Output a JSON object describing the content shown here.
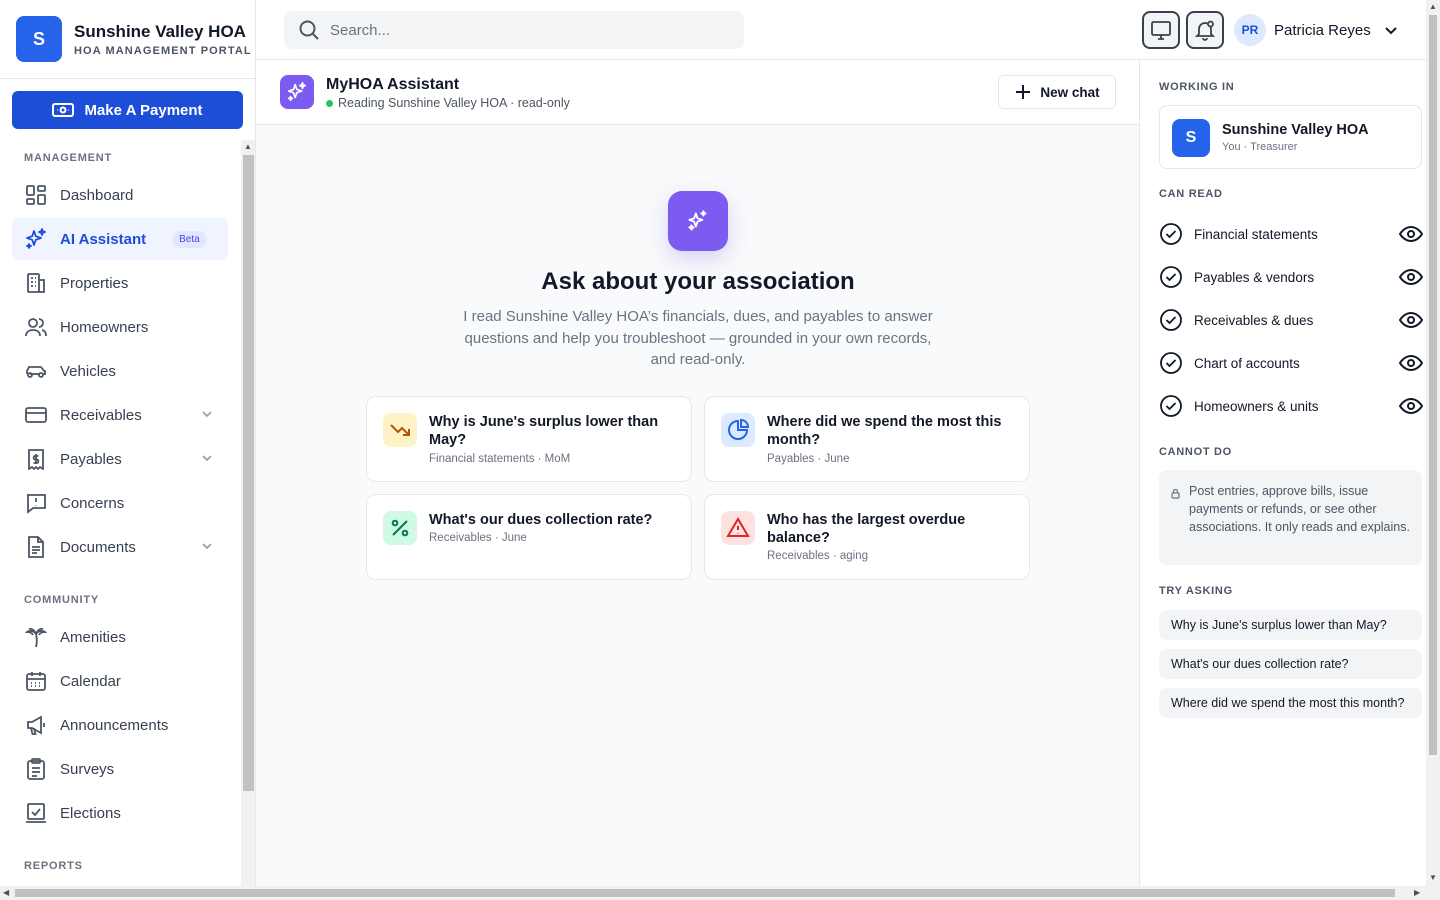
{
  "brand": {
    "logo_letter": "S",
    "name": "Sunshine Valley HOA",
    "subtitle": "HOA MANAGEMENT PORTAL"
  },
  "pay_button": {
    "label": "Make A Payment"
  },
  "sidebar": {
    "section_management": "MANAGEMENT",
    "section_community": "COMMUNITY",
    "section_reports": "REPORTS",
    "items": [
      {
        "label": "Dashboard",
        "icon": "dashboard-icon"
      },
      {
        "label": "AI Assistant",
        "icon": "sparkles-icon",
        "badge": "Beta",
        "active": true
      },
      {
        "label": "Properties",
        "icon": "building-icon"
      },
      {
        "label": "Homeowners",
        "icon": "users-icon"
      },
      {
        "label": "Vehicles",
        "icon": "car-icon"
      },
      {
        "label": "Receivables",
        "icon": "credit-card-icon",
        "expandable": true
      },
      {
        "label": "Payables",
        "icon": "receipt-icon",
        "expandable": true
      },
      {
        "label": "Concerns",
        "icon": "alert-message-icon"
      },
      {
        "label": "Documents",
        "icon": "document-icon",
        "expandable": true
      }
    ],
    "community_items": [
      {
        "label": "Amenities",
        "icon": "palm-tree-icon"
      },
      {
        "label": "Calendar",
        "icon": "calendar-icon"
      },
      {
        "label": "Announcements",
        "icon": "megaphone-icon"
      },
      {
        "label": "Surveys",
        "icon": "clipboard-icon"
      },
      {
        "label": "Elections",
        "icon": "ballot-icon"
      }
    ]
  },
  "search": {
    "placeholder": "Search..."
  },
  "user": {
    "initials": "PR",
    "name": "Patricia Reyes"
  },
  "chat": {
    "assistant_name": "MyHOA Assistant",
    "status": "Reading Sunshine Valley HOA · read-only",
    "new_chat_label": "New chat",
    "hero_title": "Ask about your association",
    "hero_desc": "I read Sunshine Valley HOA’s financials, dues, and payables to answer questions and help you troubleshoot — grounded in your own records, and read-only.",
    "suggestions": [
      {
        "title": "Why is June's surplus lower than May?",
        "sub": "Financial statements · MoM",
        "icon": "trending-down-icon"
      },
      {
        "title": "Where did we spend the most this month?",
        "sub": "Payables · June",
        "icon": "pie-chart-icon"
      },
      {
        "title": "What's our dues collection rate?",
        "sub": "Receivables · June",
        "icon": "percent-icon"
      },
      {
        "title": "Who has the largest overdue balance?",
        "sub": "Receivables · aging",
        "icon": "warning-icon"
      }
    ]
  },
  "right_panel": {
    "working_in_label": "WORKING IN",
    "org_letter": "S",
    "org_name": "Sunshine Valley HOA",
    "org_role": "You · Treasurer",
    "can_read_label": "CAN READ",
    "can_read": [
      "Financial statements",
      "Payables & vendors",
      "Receivables & dues",
      "Chart of accounts",
      "Homeowners & units"
    ],
    "cannot_do_label": "CANNOT DO",
    "cannot_do_text": "Post entries, approve bills, issue payments or refunds, or see other associations. It only reads and explains.",
    "try_asking_label": "TRY ASKING",
    "try_asking": [
      "Why is June's surplus lower than May?",
      "What's our dues collection rate?",
      "Where did we spend the most this month?"
    ]
  },
  "colors": {
    "primary": "#1d4ed8",
    "assistant": "#7c5cf0",
    "online": "#22c55e"
  }
}
